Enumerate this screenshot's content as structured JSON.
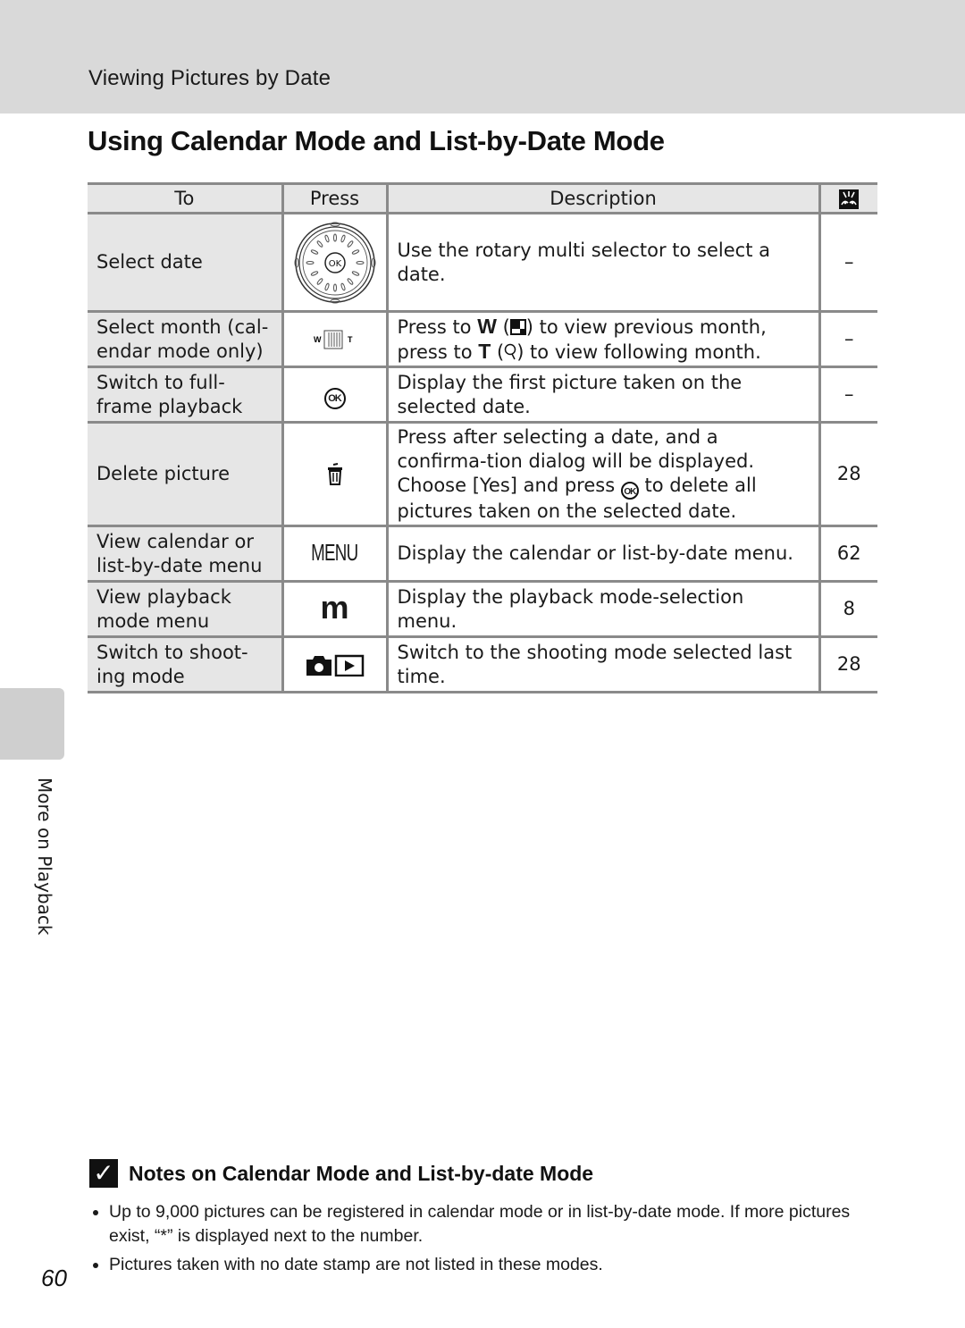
{
  "header": {
    "section_title": "Viewing Pictures by Date",
    "page_title": "Using Calendar Mode and List-by-Date Mode"
  },
  "table": {
    "columns": [
      "To",
      "Press",
      "Description",
      "reference-page-icon"
    ],
    "rows": [
      {
        "to": "Select date",
        "press_icon": "rotary-multi-selector-icon",
        "description": "Use the rotary multi selector to select a date.",
        "page": "–"
      },
      {
        "to": "Select month (cal-endar mode only)",
        "press_icon": "zoom-control-icon",
        "description_parts": [
          "Press to ",
          "W",
          " (",
          "thumbnail-icon",
          ") to view previous month,",
          "press to ",
          "T",
          " (",
          "zoom-icon",
          ") to view following month."
        ],
        "page": "–"
      },
      {
        "to": "Switch to full-frame playback",
        "press_icon": "ok-button-icon",
        "description": "Display the first picture taken on the selected date.",
        "page": "–"
      },
      {
        "to": "Delete picture",
        "press_icon": "delete-icon",
        "description_parts": [
          "Press after selecting a date, and a confirma-tion dialog will be displayed. Choose [Yes] and press ",
          "ok-button-icon",
          " to delete all pictures taken on the selected date."
        ],
        "page": "28"
      },
      {
        "to": "View calendar or list-by-date menu",
        "press_icon": "menu-button-icon",
        "press_text": "MENU",
        "description": "Display the calendar or list-by-date menu.",
        "page": "62"
      },
      {
        "to": "View playback mode menu",
        "press_icon": "mode-button-icon",
        "press_text": "m",
        "description": "Display the playback mode-selection menu.",
        "page": "8"
      },
      {
        "to": "Switch to shooting mode",
        "press_icon": "shooting-playback-button-icon",
        "description": "Switch to the shooting mode selected last time.",
        "page": "28"
      }
    ],
    "row_labels": {
      "r0": "Select date",
      "r1a": "Select month (cal-",
      "r1b": "endar mode only)",
      "r2a": "Switch to full-",
      "r2b": "frame playback",
      "r3": "Delete picture",
      "r4a": "View calendar or",
      "r4b": "list-by-date menu",
      "r5a": "View playback",
      "r5b": "mode menu",
      "r6a": "Switch to shoot-",
      "r6b": "ing mode"
    },
    "desc": {
      "r0": "Use the rotary multi selector to select a date.",
      "r1_press_to": "Press to ",
      "r1_w": "W",
      "r1_prev": ") to view previous month,",
      "r1_press_to2": "press to ",
      "r1_t": "T",
      "r1_next": ") to view following month.",
      "open_paren": " (",
      "r2": "Display the first picture taken on the selected date.",
      "r3_a": "Press after selecting a date, and a confirma-tion dialog will be displayed. Choose [Yes] and press ",
      "r3_b": " to delete all pictures taken on the selected date.",
      "r4": "Display the calendar or list-by-date menu.",
      "r5": "Display the playback mode-selection menu.",
      "r6": "Switch to the shooting mode selected last time."
    },
    "pages": {
      "r0": "–",
      "r1": "–",
      "r2": "–",
      "r3": "28",
      "r4": "62",
      "r5": "8",
      "r6": "28"
    },
    "press_text": {
      "menu": "MENU",
      "mode": "m",
      "ok": "OK",
      "w": "W",
      "t": "T"
    }
  },
  "side_tab": {
    "label": "More on Playback"
  },
  "note": {
    "icon": "check-icon",
    "title": "Notes on Calendar Mode and List-by-date Mode",
    "bullets": [
      "Up to 9,000 pictures can be registered in calendar mode or in list-by-date mode. If more pictures exist, “*” is displayed next to the number.",
      "Pictures taken with no date stamp are not listed in these modes."
    ]
  },
  "page_number": "60"
}
